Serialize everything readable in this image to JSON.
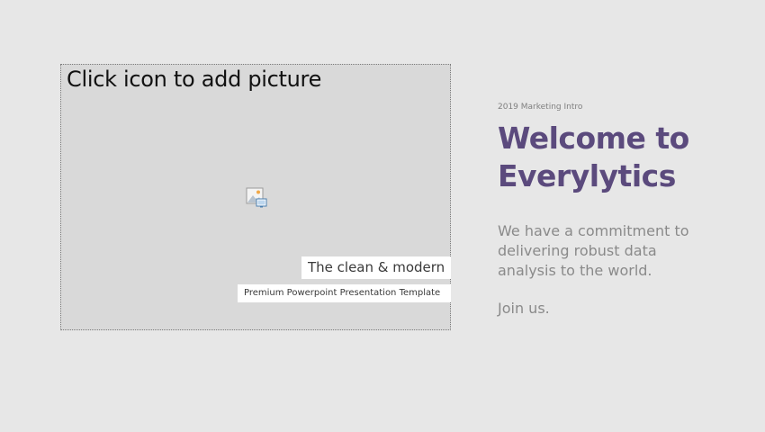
{
  "placeholder": {
    "hint": "Click icon to add picture",
    "icon": "picture-icon"
  },
  "captions": {
    "main": "The clean & modern",
    "sub": "Premium Powerpoint Presentation Template"
  },
  "hero": {
    "eyebrow": "2019 Marketing Intro",
    "title_lines": [
      "Welcome to",
      "Everylytics"
    ],
    "body_lines": [
      "We have a commitment to",
      "delivering robust data",
      "analysis to the world."
    ],
    "join": "Join us."
  },
  "colors": {
    "background": "#e7e7e7",
    "placeholder_fill": "#d9d9d9",
    "title": "#5b4a7d",
    "body": "#8a8a8a"
  }
}
